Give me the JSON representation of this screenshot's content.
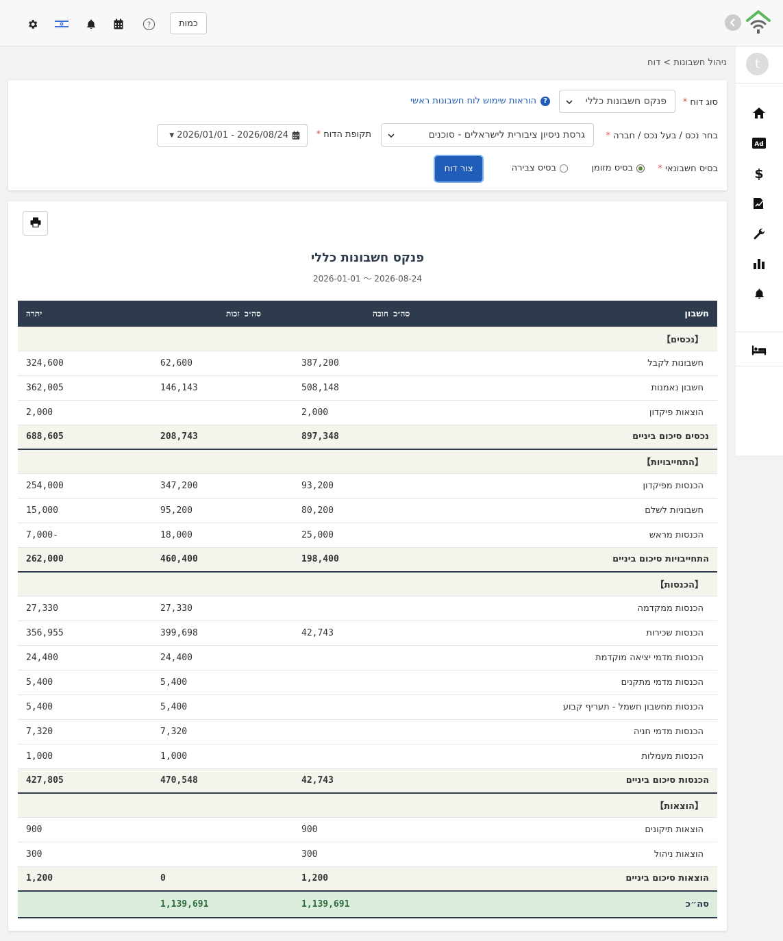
{
  "topbar": {
    "units_button": "כמות",
    "icons": [
      "gear-icon",
      "israel-flag-icon",
      "bell-icon",
      "calendar-icon",
      "help-icon"
    ]
  },
  "sidebar": {
    "avatar_initial": "t",
    "items": [
      "home-icon",
      "ads-icon",
      "dollar-icon",
      "contract-icon",
      "wrench-icon",
      "chart-icon",
      "bell-icon",
      "bed-icon"
    ]
  },
  "breadcrumb": "ניהול חשבונות > דוח",
  "filters": {
    "report_type_label": "סוג דוח",
    "report_type_value": "פנקס חשבונות כללי",
    "help_link": "הוראות שימוש לוח חשבונות ראשי",
    "entity_label": "בחר נכס / בעל נכס / חברה",
    "entity_value": "גרסת ניסיון ציבורית לישראלים - סוכנים",
    "period_label": "תקופת הדוח",
    "period_value": "2026/01/01 - 2026/08/24",
    "basis_label": "בסיס חשבונאי",
    "basis_cash": "בסיס מזומן",
    "basis_accrual": "בסיס צבירה",
    "generate_button": "צור דוח"
  },
  "report": {
    "title": "פנקס חשבונות כללי",
    "date_range": "2026-01-01 〜 2026-08-24",
    "columns": {
      "account": "חשבון",
      "debit": "סה״כ חובה",
      "credit": "סה״כ זכות",
      "balance": "יתרה"
    },
    "sections": [
      {
        "name": "【נכסים】",
        "rows": [
          {
            "account": "חשבונות לקבל",
            "debit": "387,200",
            "credit": "62,600",
            "balance": "324,600"
          },
          {
            "account": "חשבון נאמנות",
            "debit": "508,148",
            "credit": "146,143",
            "balance": "362,005"
          },
          {
            "account": "הוצאות פיקדון",
            "debit": "2,000",
            "credit": "",
            "balance": "2,000"
          }
        ],
        "subtotal": {
          "account": "נכסים סיכום ביניים",
          "debit": "897,348",
          "credit": "208,743",
          "balance": "688,605"
        }
      },
      {
        "name": "【התחייבויות】",
        "rows": [
          {
            "account": "הכנסות מפיקדון",
            "debit": "93,200",
            "credit": "347,200",
            "balance": "254,000"
          },
          {
            "account": "חשבוניות לשלם",
            "debit": "80,200",
            "credit": "95,200",
            "balance": "15,000"
          },
          {
            "account": "הכנסות מראש",
            "debit": "25,000",
            "credit": "18,000",
            "balance": "-7,000"
          }
        ],
        "subtotal": {
          "account": "התחייבויות סיכום ביניים",
          "debit": "198,400",
          "credit": "460,400",
          "balance": "262,000"
        }
      },
      {
        "name": "【הכנסות】",
        "rows": [
          {
            "account": "הכנסות ממקדמה",
            "debit": "",
            "credit": "27,330",
            "balance": "27,330"
          },
          {
            "account": "הכנסות שכירות",
            "debit": "42,743",
            "credit": "399,698",
            "balance": "356,955"
          },
          {
            "account": "הכנסות מדמי יציאה מוקדמת",
            "debit": "",
            "credit": "24,400",
            "balance": "24,400"
          },
          {
            "account": "הכנסות מדמי מתקנים",
            "debit": "",
            "credit": "5,400",
            "balance": "5,400"
          },
          {
            "account": "הכנסות מחשבון חשמל - תעריף קבוע",
            "debit": "",
            "credit": "5,400",
            "balance": "5,400"
          },
          {
            "account": "הכנסות מדמי חניה",
            "debit": "",
            "credit": "7,320",
            "balance": "7,320"
          },
          {
            "account": "הכנסות מעמלות",
            "debit": "",
            "credit": "1,000",
            "balance": "1,000"
          }
        ],
        "subtotal": {
          "account": "הכנסות סיכום ביניים",
          "debit": "42,743",
          "credit": "470,548",
          "balance": "427,805"
        }
      },
      {
        "name": "【הוצאות】",
        "rows": [
          {
            "account": "הוצאות תיקונים",
            "debit": "900",
            "credit": "",
            "balance": "900"
          },
          {
            "account": "הוצאות ניהול",
            "debit": "300",
            "credit": "",
            "balance": "300"
          }
        ],
        "subtotal": {
          "account": "הוצאות סיכום ביניים",
          "debit": "1,200",
          "credit": "0",
          "balance": "1,200"
        }
      }
    ],
    "total": {
      "account": "סה״כ",
      "debit": "1,139,691",
      "credit": "1,139,691",
      "balance": ""
    }
  }
}
